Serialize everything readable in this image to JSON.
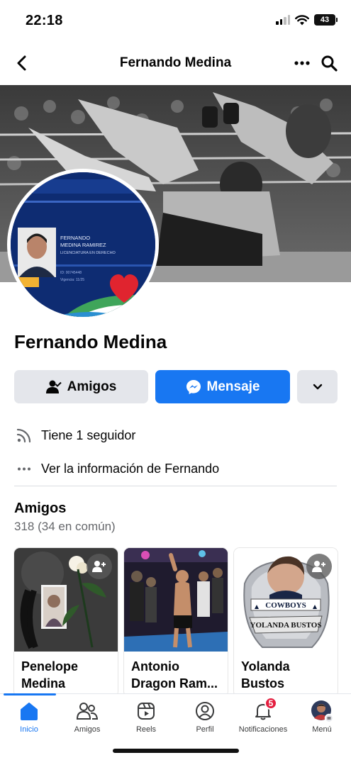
{
  "status_bar": {
    "time": "22:18",
    "battery": "43"
  },
  "header": {
    "title": "Fernando Medina"
  },
  "profile": {
    "name": "Fernando Medina",
    "id_card": {
      "line1": "FERNANDO",
      "line2": "MEDINA RAMIREZ",
      "line3": "LICENCIATURA EN DERECHO",
      "line4": "ID: 00745448",
      "line5": "Vigencia: 11/25"
    }
  },
  "actions": {
    "amigos_label": "Amigos",
    "mensaje_label": "Mensaje"
  },
  "details": {
    "followers": "Tiene 1 seguidor",
    "see_info": "Ver la información de Fernando"
  },
  "friends": {
    "title": "Amigos",
    "count": "318 (34 en común)",
    "items": [
      {
        "name": "Penelope Medina"
      },
      {
        "name": "Antonio Dragon Ram..."
      },
      {
        "name": "Yolanda Bustos",
        "ring_top": "COWBOYS",
        "ring_band": "YOLANDA BUSTOS"
      }
    ]
  },
  "tabs": [
    {
      "label": "Inicio"
    },
    {
      "label": "Amigos"
    },
    {
      "label": "Reels"
    },
    {
      "label": "Perfil"
    },
    {
      "label": "Notificaciones",
      "badge": "5"
    },
    {
      "label": "Menú"
    }
  ],
  "colors": {
    "accent": "#1877f2",
    "badge": "#e41e3f",
    "button_gray": "#e4e6eb"
  }
}
